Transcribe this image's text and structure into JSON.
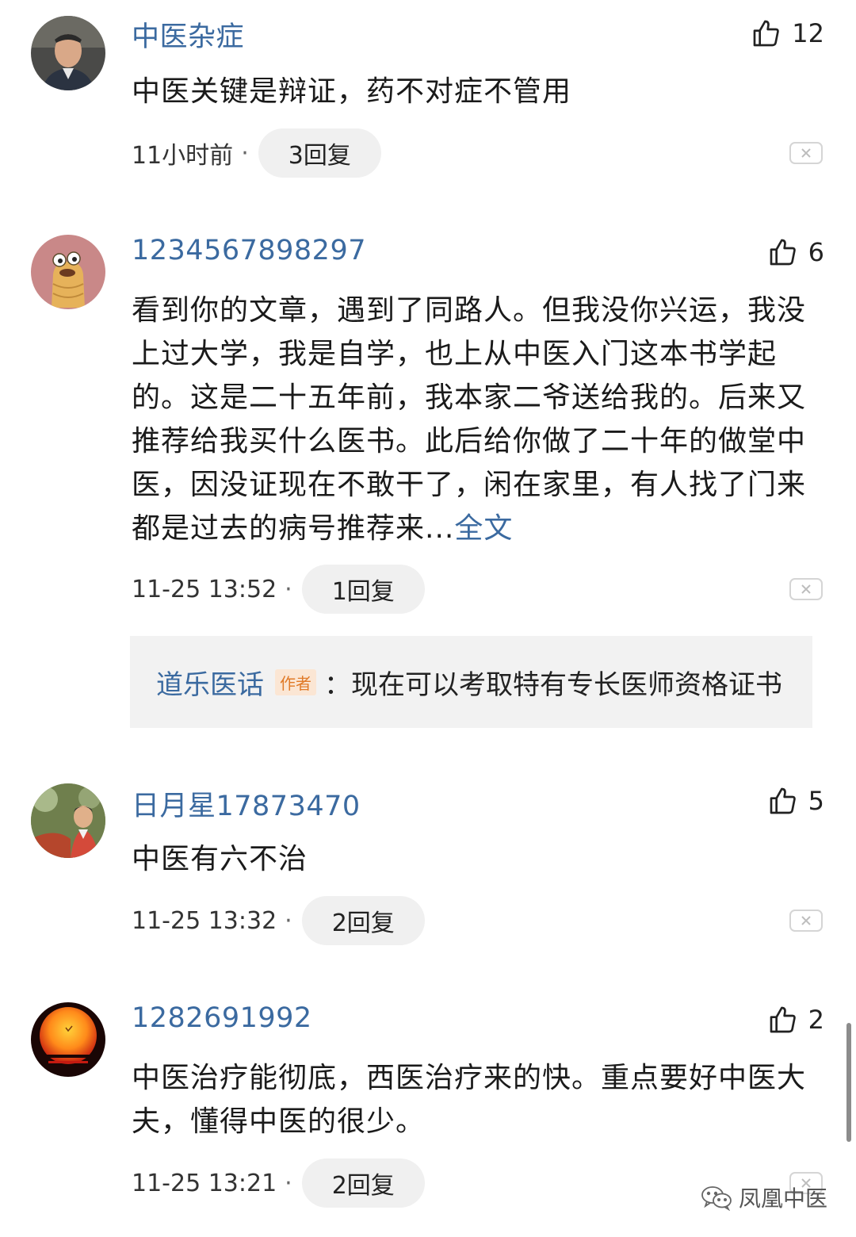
{
  "colors": {
    "link": "#3b6aa0",
    "reply_bg": "#f0f0f0",
    "author_badge": "#e07a28"
  },
  "comments": [
    {
      "username": "中医杂症",
      "likes": "12",
      "text": "中医关键是辩证，药不对症不管用",
      "time": "11小时前",
      "dot": "·",
      "replies": "3回复"
    },
    {
      "username": "1234567898297",
      "likes": "6",
      "text": "看到你的文章，遇到了同路人。但我没你兴运，我没上过大学，我是自学，也上从中医入门这本书学起的。这是二十五年前，我本家二爷送给我的。后来又推荐给我买什么医书。此后给你做了二十年的做堂中医，因没证现在不敢干了，闲在家里，有人找了门来都是过去的病号推荐来...",
      "more": "全文",
      "time": "11-25 13:52",
      "dot": "·",
      "replies": "1回复",
      "author_reply": {
        "name": "道乐医话",
        "badge": "作者",
        "text": "：现在可以考取特有专长医师资格证书"
      }
    },
    {
      "username": "日月星17873470",
      "likes": "5",
      "text": "中医有六不治",
      "time": "11-25 13:32",
      "dot": "·",
      "replies": "2回复"
    },
    {
      "username": "1282691992",
      "likes": "2",
      "text": "中医治疗能彻底，西医治疗来的快。重点要好中医大夫，懂得中医的很少。",
      "time": "11-25 13:21",
      "dot": "·",
      "replies": "2回复"
    }
  ],
  "watermark": {
    "text": "凤凰中医",
    "icon": "wechat-icon"
  },
  "icons": {
    "like": "thumbs-up-icon",
    "close": "close-icon"
  }
}
